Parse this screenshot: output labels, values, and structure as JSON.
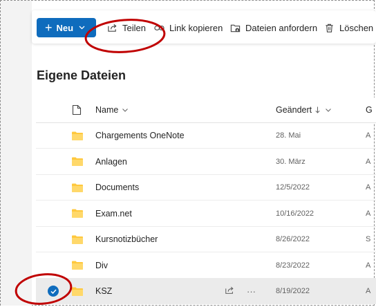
{
  "toolbar": {
    "new_label": "Neu",
    "share_label": "Teilen",
    "copy_link_label": "Link kopieren",
    "request_files_label": "Dateien anfordern",
    "delete_label": "Löschen",
    "accent_color": "#0f6cbd"
  },
  "page": {
    "title": "Eigene Dateien"
  },
  "list": {
    "columns": {
      "file_type_icon": "file-icon",
      "name": "Name",
      "modified": "Geändert",
      "modified_by_truncated": "G"
    },
    "rows": [
      {
        "name": "Chargements OneNote",
        "modified": "28. Mai",
        "modified_by_truncated": "A",
        "selected": false
      },
      {
        "name": "Anlagen",
        "modified": "30. März",
        "modified_by_truncated": "A",
        "selected": false
      },
      {
        "name": "Documents",
        "modified": "12/5/2022",
        "modified_by_truncated": "A",
        "selected": false
      },
      {
        "name": "Exam.net",
        "modified": "10/16/2022",
        "modified_by_truncated": "A",
        "selected": false
      },
      {
        "name": "Kursnotizbücher",
        "modified": "8/26/2022",
        "modified_by_truncated": "S",
        "selected": false
      },
      {
        "name": "Div",
        "modified": "8/23/2022",
        "modified_by_truncated": "A",
        "selected": false
      },
      {
        "name": "KSZ",
        "modified": "8/19/2022",
        "modified_by_truncated": "A",
        "selected": true,
        "more_label": "···"
      }
    ],
    "folder_color": "#ffc83d",
    "annotation_color": "#c00000"
  }
}
